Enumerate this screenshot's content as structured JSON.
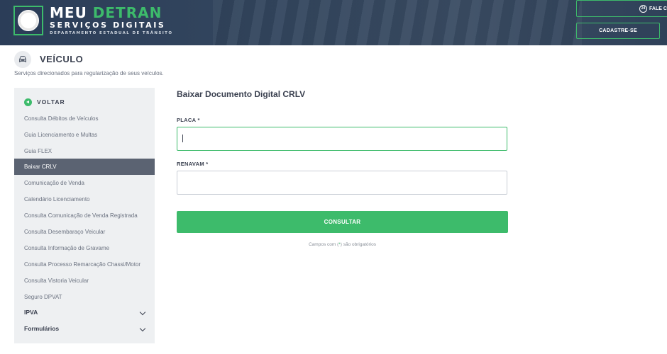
{
  "header": {
    "logo_title_a": "MEU",
    "logo_title_b": "DETRAN",
    "logo_subtitle": "SERVIÇOS DIGITAIS",
    "logo_subtitle2": "DEPARTAMENTO ESTADUAL DE TRÂNSITO",
    "fale_label": "FALE C",
    "fale_icon_text": "24",
    "cadastre_label": "CADASTRE-SE",
    "accent_color": "#3dbb6b",
    "background_color": "#2b3d58"
  },
  "page": {
    "title": "VEÍCULO",
    "description": "Serviços direcionados para regularização de seus veículos.",
    "icon": "car-icon"
  },
  "sidebar": {
    "back_label": "VOLTAR",
    "items": [
      {
        "label": "Consulta Débitos de Veículos"
      },
      {
        "label": "Guia Licenciamento e Multas"
      },
      {
        "label": "Guia FLEX"
      },
      {
        "label": "Baixar CRLV",
        "active": true
      },
      {
        "label": "Comunicação de Venda"
      },
      {
        "label": "Calendário Licenciamento"
      },
      {
        "label": "Consulta Comunicação de Venda Registrada"
      },
      {
        "label": "Consulta Desembaraço Veicular"
      },
      {
        "label": "Consulta Informação de Gravame"
      },
      {
        "label": "Consulta Processo Remarcação Chassi/Motor"
      },
      {
        "label": "Consulta Vistoria Veicular"
      },
      {
        "label": "Seguro DPVAT"
      }
    ],
    "groups": [
      {
        "label": "IPVA"
      },
      {
        "label": "Formulários"
      }
    ]
  },
  "form": {
    "title": "Baixar Documento Digital CRLV",
    "placa_label": "PLACA *",
    "placa_value": "",
    "renavam_label": "RENAVAM *",
    "renavam_value": "",
    "submit_label": "CONSULTAR",
    "note_prefix": "Campos com (",
    "note_star": "*",
    "note_suffix": ") são obrigatórios"
  }
}
